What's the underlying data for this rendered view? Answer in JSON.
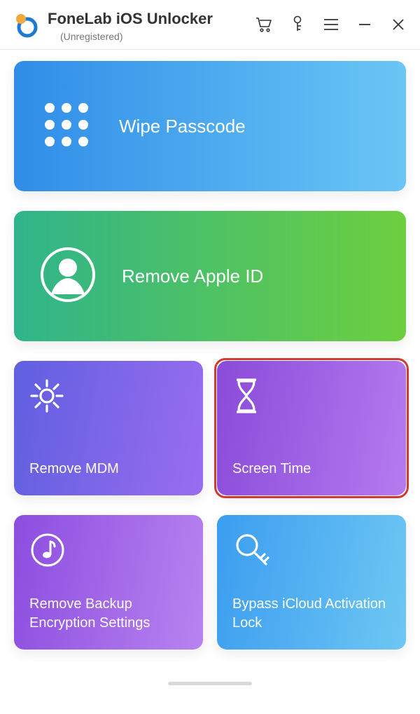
{
  "header": {
    "title": "FoneLab iOS Unlocker",
    "subtitle": "(Unregistered)"
  },
  "cards": {
    "wipe": {
      "label": "Wipe Passcode"
    },
    "appleid": {
      "label": "Remove Apple ID"
    },
    "mdm": {
      "label": "Remove MDM"
    },
    "screentime": {
      "label": "Screen Time"
    },
    "backup": {
      "label": "Remove Backup Encryption Settings"
    },
    "icloud": {
      "label": "Bypass iCloud Activation Lock"
    }
  }
}
